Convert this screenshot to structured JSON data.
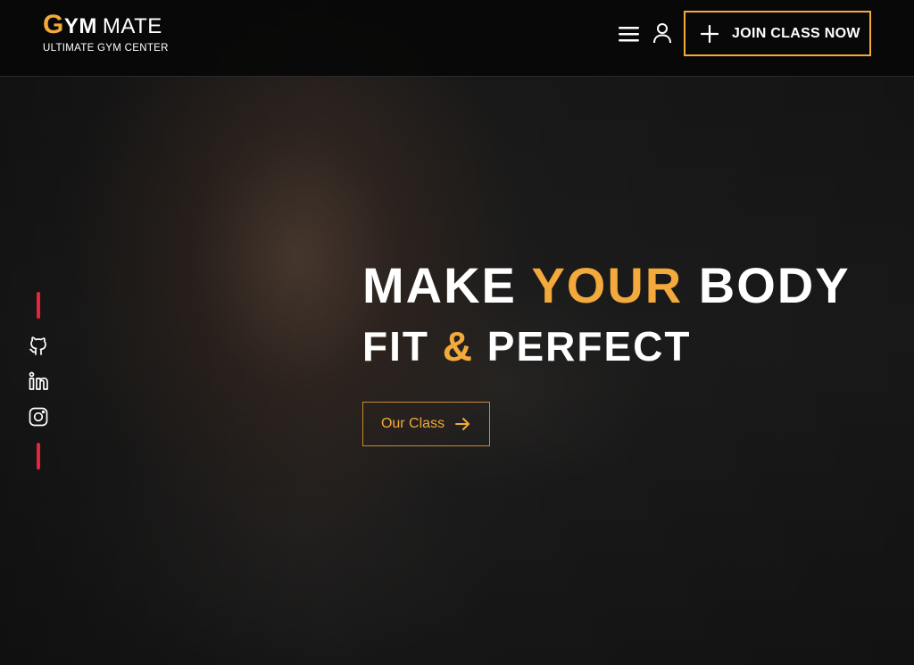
{
  "brand": {
    "logo_initial": "G",
    "logo_rest_bold": "YM",
    "logo_rest_light": "MATE",
    "tagline": "ULTIMATE GYM CENTER"
  },
  "header": {
    "menu_icon": "hamburger-menu-icon",
    "user_icon": "user-icon",
    "join_button_label": "JOIN CLASS NOW",
    "join_button_icon": "plus-icon"
  },
  "social": {
    "items": [
      "github-icon",
      "linkedin-icon",
      "instagram-icon"
    ]
  },
  "hero": {
    "line1_a": "MAKE",
    "line1_b": "YOUR",
    "line1_c": "BODY",
    "line2_a": "FIT",
    "line2_b": "&",
    "line2_c": "PERFECT",
    "cta_label": "Our Class",
    "cta_icon": "arrow-right-icon"
  },
  "colors": {
    "accent": "#f3a93b",
    "rail": "#e8243d",
    "header_bg": "#080808",
    "text": "#ffffff"
  }
}
